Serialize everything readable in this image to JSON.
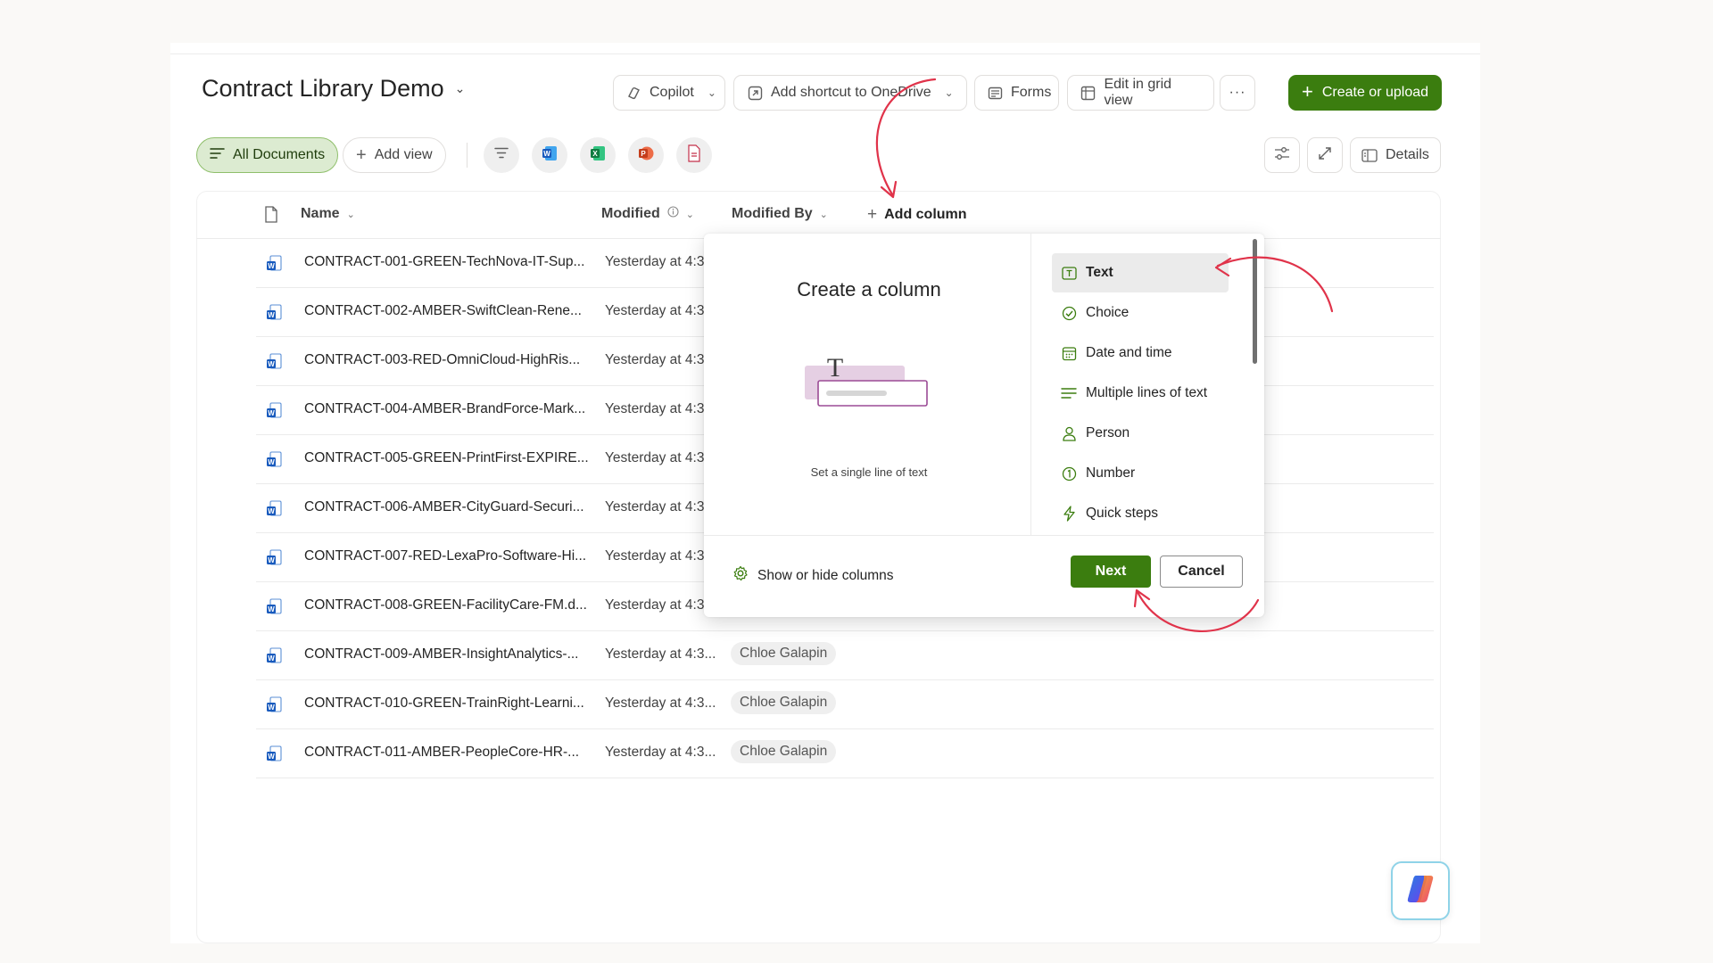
{
  "library": {
    "title": "Contract Library Demo"
  },
  "commands": {
    "copilot": "Copilot",
    "shortcut": "Add shortcut to OneDrive",
    "forms": "Forms",
    "grid": "Edit in grid view",
    "more": "···",
    "create": "Create or upload"
  },
  "views": {
    "all_documents": "All Documents",
    "add_view": "Add view",
    "details": "Details"
  },
  "table": {
    "headers": {
      "name": "Name",
      "modified": "Modified",
      "modified_by": "Modified By",
      "add_column": "Add column"
    },
    "rows": [
      {
        "name": "CONTRACT-001-GREEN-TechNova-IT-Sup...",
        "modified": "Yesterday at 4:3...",
        "modified_by": ""
      },
      {
        "name": "CONTRACT-002-AMBER-SwiftClean-Rene...",
        "modified": "Yesterday at 4:3...",
        "modified_by": ""
      },
      {
        "name": "CONTRACT-003-RED-OmniCloud-HighRis...",
        "modified": "Yesterday at 4:3...",
        "modified_by": ""
      },
      {
        "name": "CONTRACT-004-AMBER-BrandForce-Mark...",
        "modified": "Yesterday at 4:3...",
        "modified_by": ""
      },
      {
        "name": "CONTRACT-005-GREEN-PrintFirst-EXPIRE...",
        "modified": "Yesterday at 4:3...",
        "modified_by": ""
      },
      {
        "name": "CONTRACT-006-AMBER-CityGuard-Securi...",
        "modified": "Yesterday at 4:3...",
        "modified_by": ""
      },
      {
        "name": "CONTRACT-007-RED-LexaPro-Software-Hi...",
        "modified": "Yesterday at 4:3...",
        "modified_by": ""
      },
      {
        "name": "CONTRACT-008-GREEN-FacilityCare-FM.d...",
        "modified": "Yesterday at 4:3...",
        "modified_by": ""
      },
      {
        "name": "CONTRACT-009-AMBER-InsightAnalytics-...",
        "modified": "Yesterday at 4:3...",
        "modified_by": "Chloe Galapin"
      },
      {
        "name": "CONTRACT-010-GREEN-TrainRight-Learni...",
        "modified": "Yesterday at 4:3...",
        "modified_by": "Chloe Galapin"
      },
      {
        "name": "CONTRACT-011-AMBER-PeopleCore-HR-...",
        "modified": "Yesterday at 4:3...",
        "modified_by": "Chloe Galapin"
      }
    ]
  },
  "dialog": {
    "title": "Create a column",
    "description": "Set a single line of text",
    "types": [
      "Text",
      "Choice",
      "Date and time",
      "Multiple lines of text",
      "Person",
      "Number",
      "Quick steps"
    ],
    "selected": "Text",
    "show_hide": "Show or hide columns",
    "next": "Next",
    "cancel": "Cancel"
  },
  "colors": {
    "accent_green": "#3b7d0f",
    "annotation_red": "#e0334a"
  }
}
